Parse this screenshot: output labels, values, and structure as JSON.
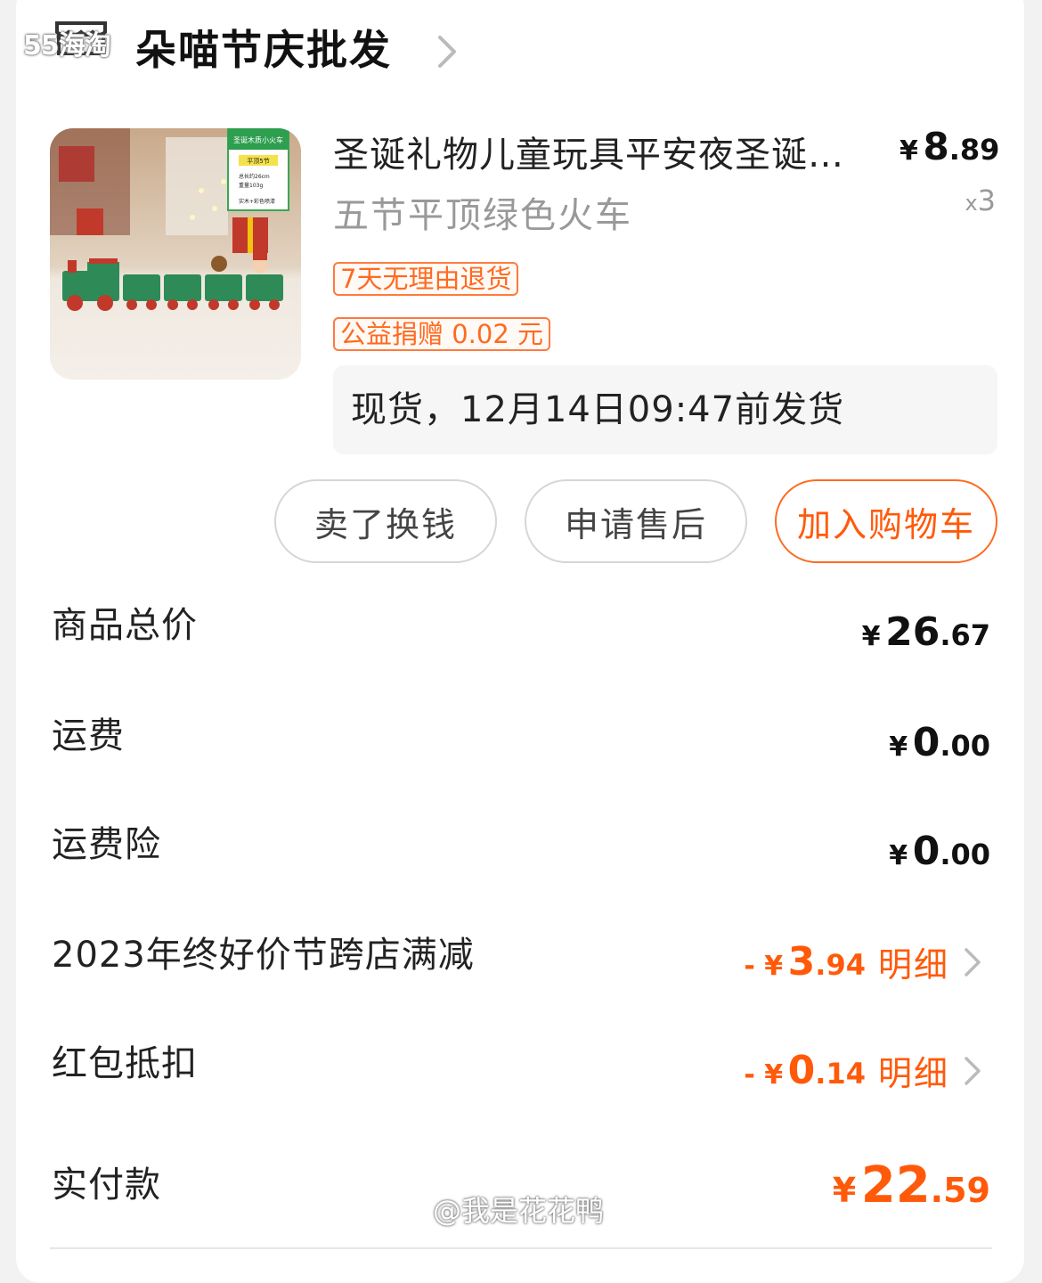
{
  "watermark_top": "55海淘",
  "shop": {
    "name": "朵喵节庆批发"
  },
  "product": {
    "image_labels": {
      "title": "圣诞木质小火车",
      "badge": "平顶5节",
      "spec1": "总长约26cm",
      "spec2": "重量103g",
      "material": "实木+彩色喷漆"
    },
    "title": "圣诞礼物儿童玩具平安夜圣诞节装饰品木质小火车",
    "variant": "五节平顶绿色火车",
    "price": {
      "currency": "¥",
      "int": "8",
      "dec": ".89"
    },
    "qty_prefix": "x",
    "qty": "3",
    "tags": [
      "7天无理由退货",
      "公益捐赠 0.02 元"
    ],
    "shipping": "现货，12月14日09:47前发货"
  },
  "actions": {
    "sell": "卖了换钱",
    "after_sale": "申请售后",
    "add_cart": "加入购物车"
  },
  "summary": {
    "goods_total": {
      "label": "商品总价",
      "cur": "¥",
      "int": "26",
      "dec": ".67"
    },
    "shipping_fee": {
      "label": "运费",
      "cur": "¥",
      "int": "0",
      "dec": ".00"
    },
    "shipping_insurance": {
      "label": "运费险",
      "cur": "¥",
      "int": "0",
      "dec": ".00"
    },
    "promo": {
      "label": "2023年终好价节跨店满减",
      "cur": "- ¥",
      "int": "3",
      "dec": ".94",
      "detail": "明细"
    },
    "red_packet": {
      "label": "红包抵扣",
      "cur": "- ¥",
      "int": "0",
      "dec": ".14",
      "detail": "明细"
    },
    "paid": {
      "label": "实付款",
      "cur": "¥",
      "int": "22",
      "dec": ".59"
    }
  },
  "watermark_bottom": "@我是花花鸭",
  "colors": {
    "accent": "#ff5a0a",
    "tag_border": "#ff7a3d",
    "text": "#222222",
    "muted": "#999999"
  }
}
